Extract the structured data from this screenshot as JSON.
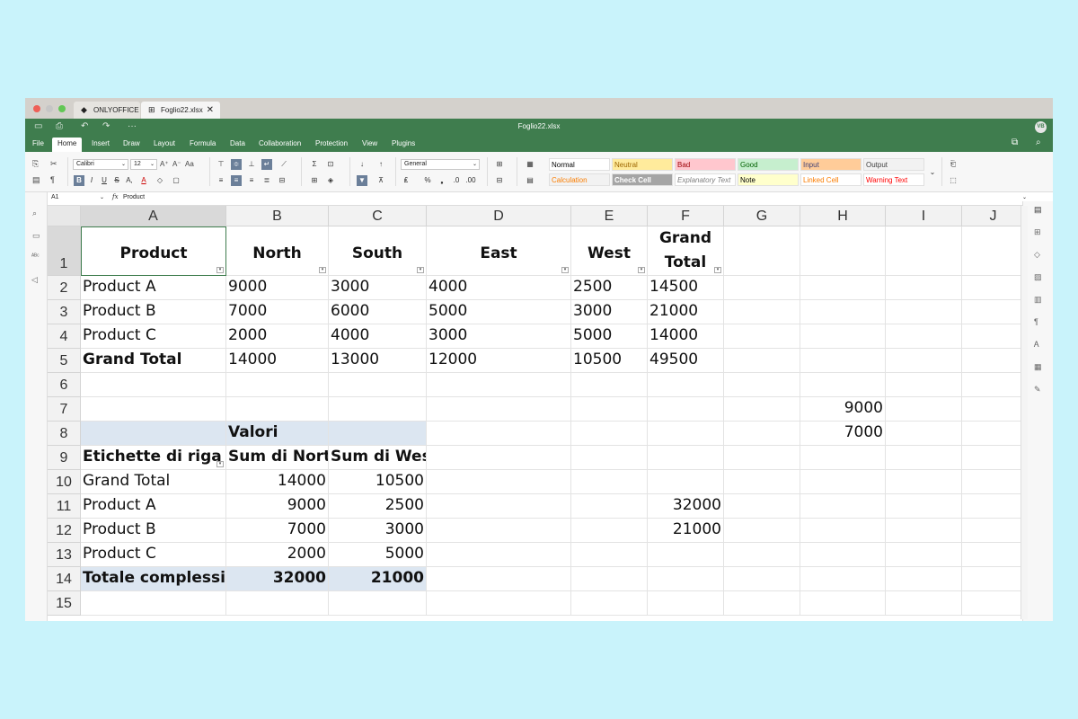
{
  "window": {
    "tabs": [
      {
        "label": "ONLYOFFICE",
        "icon": "onlyoffice-logo-icon"
      },
      {
        "label": "Foglio22.xlsx",
        "icon": "spreadsheet-icon"
      }
    ],
    "title": "Foglio22.xlsx",
    "avatar": "VB"
  },
  "menu": [
    "File",
    "Home",
    "Insert",
    "Draw",
    "Layout",
    "Formula",
    "Data",
    "Collaboration",
    "Protection",
    "View",
    "Plugins"
  ],
  "toolbar": {
    "font": "Calibri",
    "size": "12",
    "number_format": "General",
    "styles": [
      {
        "label": "Normal",
        "bg": "#ffffff",
        "color": "#000000"
      },
      {
        "label": "Neutral",
        "bg": "#ffeb9c",
        "color": "#9c6500"
      },
      {
        "label": "Bad",
        "bg": "#ffc7ce",
        "color": "#9c0006"
      },
      {
        "label": "Good",
        "bg": "#c6efce",
        "color": "#006100"
      },
      {
        "label": "Input",
        "bg": "#ffcc99",
        "color": "#3f3f76"
      },
      {
        "label": "Output",
        "bg": "#f2f2f2",
        "color": "#3f3f3f"
      },
      {
        "label": "Calculation",
        "bg": "#f2f2f2",
        "color": "#fa7d00"
      },
      {
        "label": "Check Cell",
        "bg": "#a5a5a5",
        "color": "#ffffff"
      },
      {
        "label": "Explanatory Text",
        "bg": "#ffffff",
        "color": "#7f7f7f"
      },
      {
        "label": "Note",
        "bg": "#ffffcc",
        "color": "#000000"
      },
      {
        "label": "Linked Cell",
        "bg": "#ffffff",
        "color": "#fa7d00"
      },
      {
        "label": "Warning Text",
        "bg": "#ffffff",
        "color": "#ff0000"
      }
    ]
  },
  "formula_bar": {
    "cell_ref": "A1",
    "fx": "fx",
    "content": "Product"
  },
  "columns": [
    "A",
    "B",
    "C",
    "D",
    "E",
    "F",
    "G",
    "H",
    "I",
    "J"
  ],
  "rows": [
    "1",
    "2",
    "3",
    "4",
    "5",
    "6",
    "7",
    "8",
    "9",
    "10",
    "11",
    "12",
    "13",
    "14",
    "15"
  ],
  "cells": {
    "A1": "Product",
    "B1": "North",
    "C1": "South",
    "D1": "East",
    "E1": "West",
    "F1a": "Grand",
    "F1b": "Total",
    "A2": "Product A",
    "B2": "9000",
    "C2": "3000",
    "D2": "4000",
    "E2": "2500",
    "F2": "14500",
    "A3": "Product B",
    "B3": "7000",
    "C3": "6000",
    "D3": "5000",
    "E3": "3000",
    "F3": "21000",
    "A4": "Product C",
    "B4": "2000",
    "C4": "4000",
    "D4": "3000",
    "E4": "5000",
    "F4": "14000",
    "A5": "Grand Total",
    "B5": "14000",
    "C5": "13000",
    "D5": "12000",
    "E5": "10500",
    "F5": "49500",
    "H7": "9000",
    "H8": "7000",
    "B8": "Valori",
    "A9": "Etichette di riga",
    "B9": "Sum di North",
    "C9": "Sum di West",
    "A10": "Grand Total",
    "B10": "14000",
    "C10": "10500",
    "A11": "Product A",
    "B11": "9000",
    "C11": "2500",
    "F11": "32000",
    "A12": "Product B",
    "B12": "7000",
    "C12": "3000",
    "F12": "21000",
    "A13": "Product C",
    "B13": "2000",
    "C13": "5000",
    "A14": "Totale complessivo",
    "B14": "32000",
    "C14": "21000"
  }
}
